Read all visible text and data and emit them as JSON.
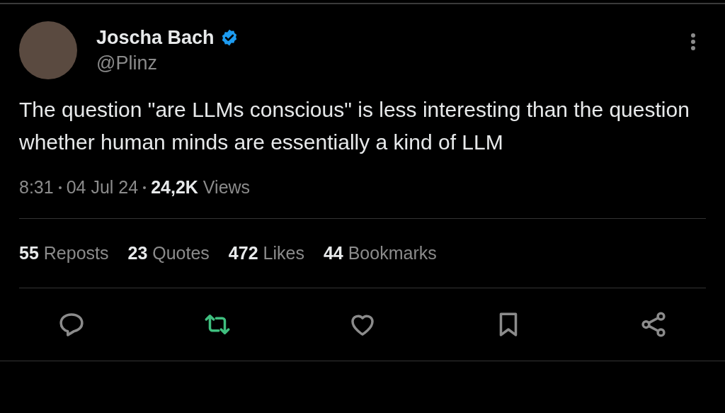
{
  "author": {
    "name": "Joscha Bach",
    "handle": "@Plinz",
    "verified": true
  },
  "text": "The question \"are LLMs conscious\" is less interesting than the question whether human minds are essentially a kind of LLM",
  "meta": {
    "time": "8:31",
    "date": "04 Jul 24",
    "views_count": "24,2K",
    "views_label": "Views"
  },
  "stats": [
    {
      "count": "55",
      "label": "Reposts"
    },
    {
      "count": "23",
      "label": "Quotes"
    },
    {
      "count": "472",
      "label": "Likes"
    },
    {
      "count": "44",
      "label": "Bookmarks"
    }
  ],
  "actions": [
    {
      "kind": "reply",
      "on": false
    },
    {
      "kind": "repost",
      "on": true
    },
    {
      "kind": "like",
      "on": false
    },
    {
      "kind": "bookmark",
      "on": false
    },
    {
      "kind": "share",
      "on": false
    }
  ]
}
